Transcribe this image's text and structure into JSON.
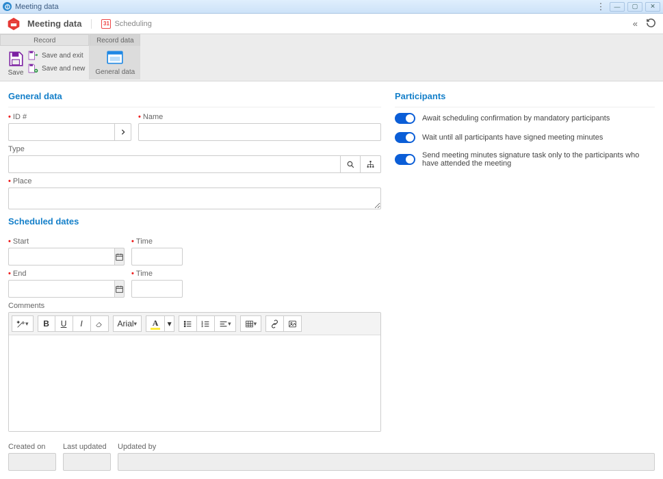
{
  "window": {
    "title": "Meeting data"
  },
  "header": {
    "title": "Meeting data",
    "scheduling": "Scheduling"
  },
  "ribbon": {
    "tab_record": "Record",
    "tab_record_data": "Record data",
    "save": "Save",
    "save_exit": "Save and exit",
    "save_new": "Save and new",
    "general_data": "General data"
  },
  "sections": {
    "general": "General data",
    "scheduled": "Scheduled dates",
    "participants": "Participants"
  },
  "labels": {
    "id": "ID #",
    "name": "Name",
    "type": "Type",
    "place": "Place",
    "start": "Start",
    "start_time": "Time",
    "end": "End",
    "end_time": "Time",
    "comments": "Comments",
    "created_on": "Created on",
    "last_updated": "Last updated",
    "updated_by": "Updated by"
  },
  "toggles": {
    "await": "Await scheduling confirmation by mandatory participants",
    "wait_signed": "Wait until all participants have signed meeting minutes",
    "send_task": "Send meeting minutes signature task only to the participants who have attended the meeting"
  },
  "editor": {
    "font": "Arial"
  },
  "values": {
    "id": "",
    "name": "",
    "type": "",
    "place": "",
    "start": "",
    "start_time": "",
    "end": "",
    "end_time": "",
    "comments": "",
    "created_on": "",
    "last_updated": "",
    "updated_by": ""
  }
}
